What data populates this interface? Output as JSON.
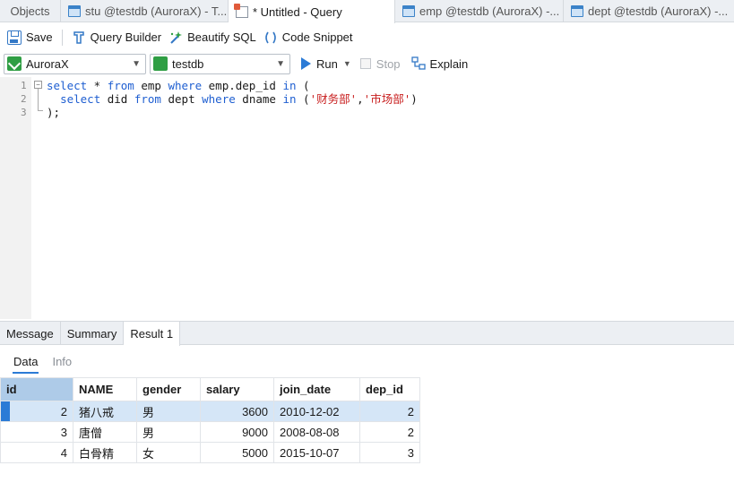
{
  "tabs": [
    {
      "label": "Objects",
      "icon": ""
    },
    {
      "label": "stu @testdb (AuroraX) - T...",
      "icon": "table-icon"
    },
    {
      "label": "* Untitled - Query",
      "icon": "query-icon"
    },
    {
      "label": "emp @testdb (AuroraX) -...",
      "icon": "table-icon"
    },
    {
      "label": "dept @testdb (AuroraX) -...",
      "icon": "table-icon"
    }
  ],
  "toolbar": {
    "save": "Save",
    "query_builder": "Query Builder",
    "beautify": "Beautify SQL",
    "code_snippet": "Code Snippet"
  },
  "toolbar2": {
    "connection": "AuroraX",
    "database": "testdb",
    "run": "Run",
    "stop": "Stop",
    "explain": "Explain"
  },
  "editor": {
    "line_numbers": [
      "1",
      "2",
      "3"
    ]
  },
  "result_tabs": [
    "Message",
    "Summary",
    "Result 1"
  ],
  "sub_tabs": [
    "Data",
    "Info"
  ],
  "grid": {
    "columns": [
      "id",
      "NAME",
      "gender",
      "salary",
      "join_date",
      "dep_id"
    ],
    "rows": [
      [
        "2",
        "猪八戒",
        "男",
        "3600",
        "2010-12-02",
        "2"
      ],
      [
        "3",
        "唐僧",
        "男",
        "9000",
        "2008-08-08",
        "2"
      ],
      [
        "4",
        "白骨精",
        "女",
        "5000",
        "2015-10-07",
        "3"
      ]
    ]
  },
  "colors": {
    "keyword": "#1f5fd1",
    "string": "#c81e1e",
    "selection": "#d5e6f7",
    "accent": "#2b7bd6"
  }
}
